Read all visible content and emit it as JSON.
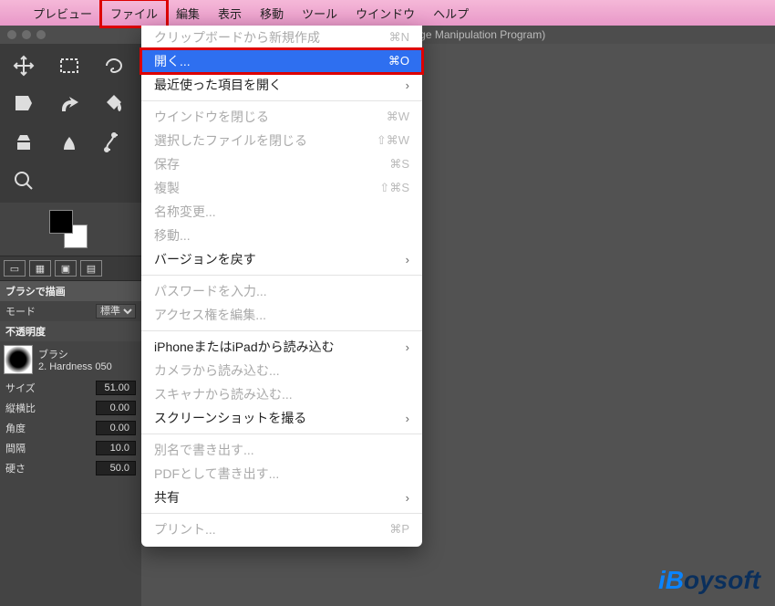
{
  "menubar": {
    "items": [
      "プレビュー",
      "ファイル",
      "編集",
      "表示",
      "移動",
      "ツール",
      "ウインドウ",
      "ヘルプ"
    ],
    "open_index": 1
  },
  "window": {
    "title_suffix": "IMP (GNU Image Manipulation Program)"
  },
  "dropdown": [
    {
      "label": "クリップボードから新規作成",
      "shortcut": "⌘N",
      "enabled": false
    },
    {
      "label": "開く...",
      "shortcut": "⌘O",
      "enabled": true,
      "selected": true
    },
    {
      "label": "最近使った項目を開く",
      "submenu": true,
      "enabled": true
    },
    {
      "sep": true
    },
    {
      "label": "ウインドウを閉じる",
      "shortcut": "⌘W",
      "enabled": false
    },
    {
      "label": "選択したファイルを閉じる",
      "shortcut": "⇧⌘W",
      "enabled": false
    },
    {
      "label": "保存",
      "shortcut": "⌘S",
      "enabled": false
    },
    {
      "label": "複製",
      "shortcut": "⇧⌘S",
      "enabled": false
    },
    {
      "label": "名称変更...",
      "enabled": false
    },
    {
      "label": "移動...",
      "enabled": false
    },
    {
      "label": "バージョンを戻す",
      "submenu": true,
      "enabled": true
    },
    {
      "sep": true
    },
    {
      "label": "パスワードを入力...",
      "enabled": false
    },
    {
      "label": "アクセス権を編集...",
      "enabled": false
    },
    {
      "sep": true
    },
    {
      "label": "iPhoneまたはiPadから読み込む",
      "submenu": true,
      "enabled": true
    },
    {
      "label": "カメラから読み込む...",
      "enabled": false
    },
    {
      "label": "スキャナから読み込む...",
      "enabled": false
    },
    {
      "label": "スクリーンショットを撮る",
      "submenu": true,
      "enabled": true
    },
    {
      "sep": true
    },
    {
      "label": "別名で書き出す...",
      "enabled": false
    },
    {
      "label": "PDFとして書き出す...",
      "enabled": false
    },
    {
      "label": "共有",
      "submenu": true,
      "enabled": true
    },
    {
      "sep": true
    },
    {
      "label": "プリント...",
      "shortcut": "⌘P",
      "enabled": false
    }
  ],
  "tooloptions": {
    "title": "ブラシで描画",
    "mode_label": "モード",
    "mode_value": "標準",
    "opacity_label": "不透明度",
    "brush_label": "ブラシ",
    "brush_name": "2. Hardness 050",
    "rows": [
      {
        "label": "サイズ",
        "value": "51.00"
      },
      {
        "label": "縦横比",
        "value": "0.00"
      },
      {
        "label": "角度",
        "value": "0.00"
      },
      {
        "label": "間隔",
        "value": "10.0"
      },
      {
        "label": "硬さ",
        "value": "50.0"
      }
    ]
  },
  "logo": {
    "part1": "iB",
    "part2": "oysoft"
  }
}
